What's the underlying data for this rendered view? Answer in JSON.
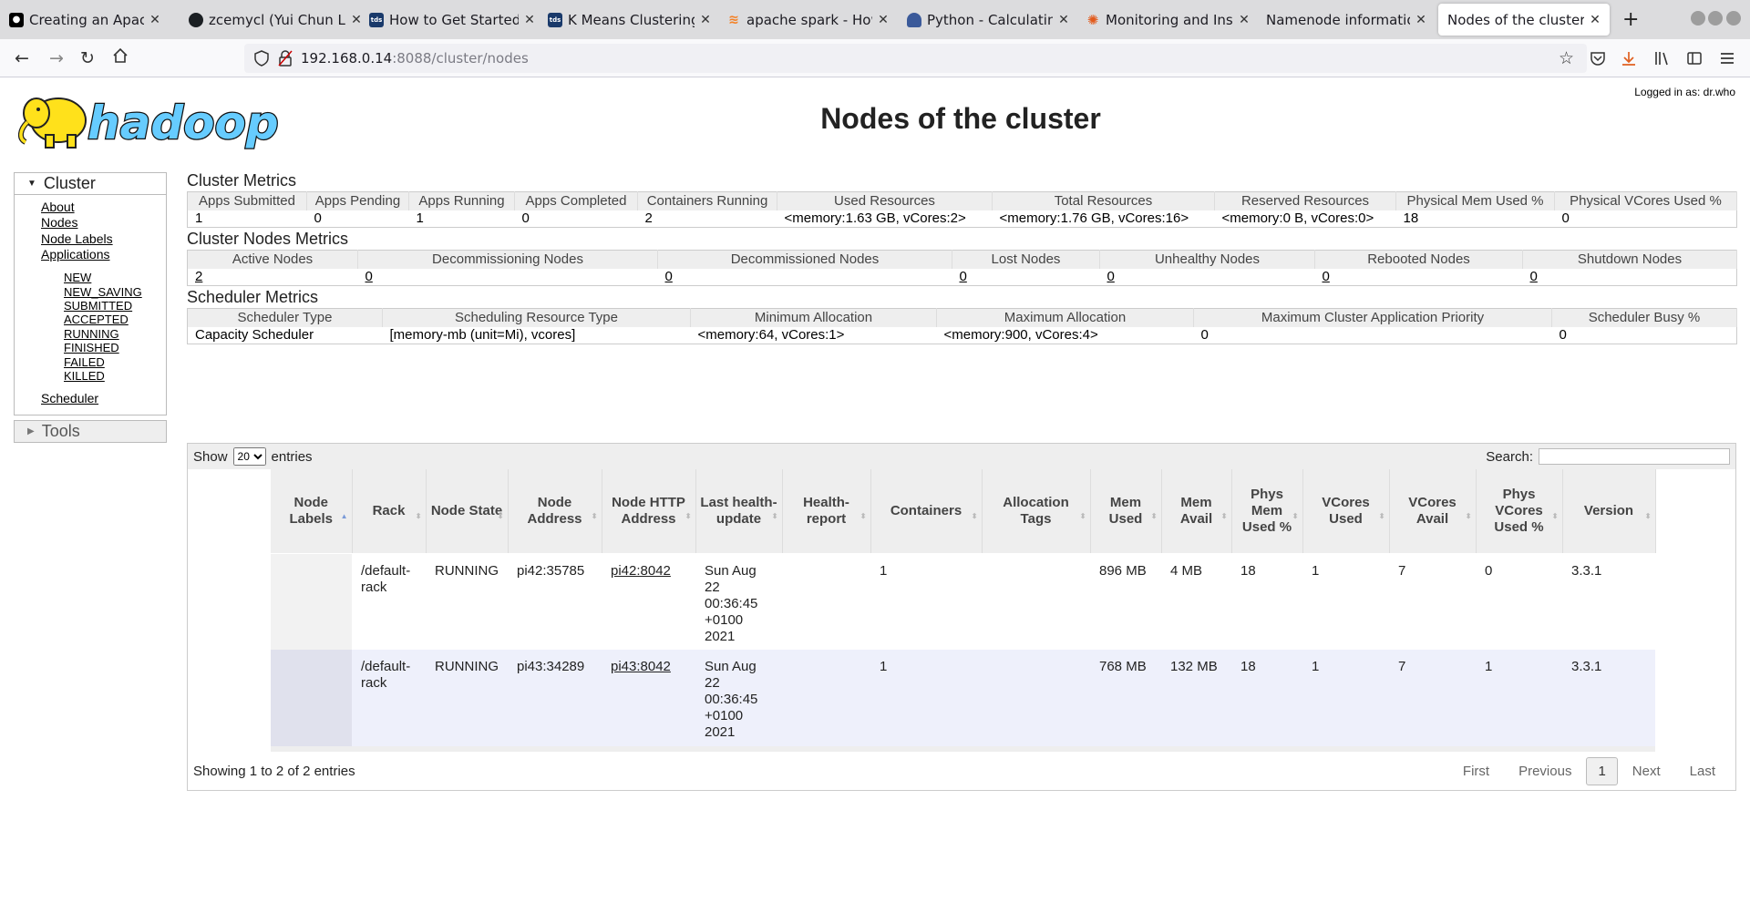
{
  "browser": {
    "tabs": [
      {
        "label": "Creating an Apache S",
        "fav_color": "#000000",
        "fav_text": ""
      },
      {
        "label": "zcemycl (Yui Chun Le",
        "fav_color": "#1b1f23",
        "fav_text": ""
      },
      {
        "label": "How to Get Started w",
        "fav_color": "#1a3a6b",
        "fav_text": "tds"
      },
      {
        "label": "K Means Clustering u",
        "fav_color": "#1a3a6b",
        "fav_text": "tds"
      },
      {
        "label": "apache spark - How t",
        "fav_color": "#f48024",
        "fav_text": ""
      },
      {
        "label": "Python - Calculating",
        "fav_color": "#3b5a9a",
        "fav_text": ""
      },
      {
        "label": "Monitoring and Instr",
        "fav_color": "#e25a1c",
        "fav_text": ""
      },
      {
        "label": "Namenode information",
        "fav_color": "",
        "fav_text": ""
      },
      {
        "label": "Nodes of the cluster",
        "fav_color": "",
        "fav_text": ""
      }
    ],
    "url_host": "192.168.0.14",
    "url_rest": ":8088/cluster/nodes"
  },
  "header": {
    "logged_in": "Logged in as: dr.who",
    "title": "Nodes of the cluster",
    "logo_text": "hadoop"
  },
  "sidebar": {
    "cluster_label": "Cluster",
    "links": [
      "About",
      "Nodes",
      "Node Labels",
      "Applications"
    ],
    "app_states": [
      "NEW",
      "NEW_SAVING",
      "SUBMITTED",
      "ACCEPTED",
      "RUNNING",
      "FINISHED",
      "FAILED",
      "KILLED"
    ],
    "scheduler": "Scheduler",
    "tools_label": "Tools"
  },
  "cluster_metrics": {
    "title": "Cluster Metrics",
    "headers": [
      "Apps Submitted",
      "Apps Pending",
      "Apps Running",
      "Apps Completed",
      "Containers Running",
      "Used Resources",
      "Total Resources",
      "Reserved Resources",
      "Physical Mem Used %",
      "Physical VCores Used %"
    ],
    "values": [
      "1",
      "0",
      "1",
      "0",
      "2",
      "<memory:1.63 GB, vCores:2>",
      "<memory:1.76 GB, vCores:16>",
      "<memory:0 B, vCores:0>",
      "18",
      "0"
    ]
  },
  "node_metrics": {
    "title": "Cluster Nodes Metrics",
    "headers": [
      "Active Nodes",
      "Decommissioning Nodes",
      "Decommissioned Nodes",
      "Lost Nodes",
      "Unhealthy Nodes",
      "Rebooted Nodes",
      "Shutdown Nodes"
    ],
    "values": [
      "2",
      "0",
      "0",
      "0",
      "0",
      "0",
      "0"
    ]
  },
  "scheduler_metrics": {
    "title": "Scheduler Metrics",
    "headers": [
      "Scheduler Type",
      "Scheduling Resource Type",
      "Minimum Allocation",
      "Maximum Allocation",
      "Maximum Cluster Application Priority",
      "Scheduler Busy %"
    ],
    "values": [
      "Capacity Scheduler",
      "[memory-mb (unit=Mi), vcores]",
      "<memory:64, vCores:1>",
      "<memory:900, vCores:4>",
      "0",
      "0"
    ]
  },
  "datatable": {
    "show_label": "Show",
    "entries_value": "20",
    "entries_label": "entries",
    "search_label": "Search:",
    "headers": [
      "Node Labels",
      "Rack",
      "Node State",
      "Node Address",
      "Node HTTP Address",
      "Last health-update",
      "Health-report",
      "Containers",
      "Allocation Tags",
      "Mem Used",
      "Mem Avail",
      "Phys Mem Used %",
      "VCores Used",
      "VCores Avail",
      "Phys VCores Used %",
      "Version"
    ],
    "rows": [
      {
        "labels": "",
        "rack": "/default-rack",
        "state": "RUNNING",
        "address": "pi42:35785",
        "http": "pi42:8042",
        "health_update": "Sun Aug 22 00:36:45 +0100 2021",
        "health_report": "",
        "containers": "1",
        "tags": "",
        "mem_used": "896 MB",
        "mem_avail": "4 MB",
        "phys_mem": "18",
        "vcores_used": "1",
        "vcores_avail": "7",
        "phys_vcores": "0",
        "version": "3.3.1"
      },
      {
        "labels": "",
        "rack": "/default-rack",
        "state": "RUNNING",
        "address": "pi43:34289",
        "http": "pi43:8042",
        "health_update": "Sun Aug 22 00:36:45 +0100 2021",
        "health_report": "",
        "containers": "1",
        "tags": "",
        "mem_used": "768 MB",
        "mem_avail": "132 MB",
        "phys_mem": "18",
        "vcores_used": "1",
        "vcores_avail": "7",
        "phys_vcores": "1",
        "version": "3.3.1"
      }
    ],
    "info": "Showing 1 to 2 of 2 entries",
    "pager": {
      "first": "First",
      "previous": "Previous",
      "current": "1",
      "next": "Next",
      "last": "Last"
    }
  }
}
